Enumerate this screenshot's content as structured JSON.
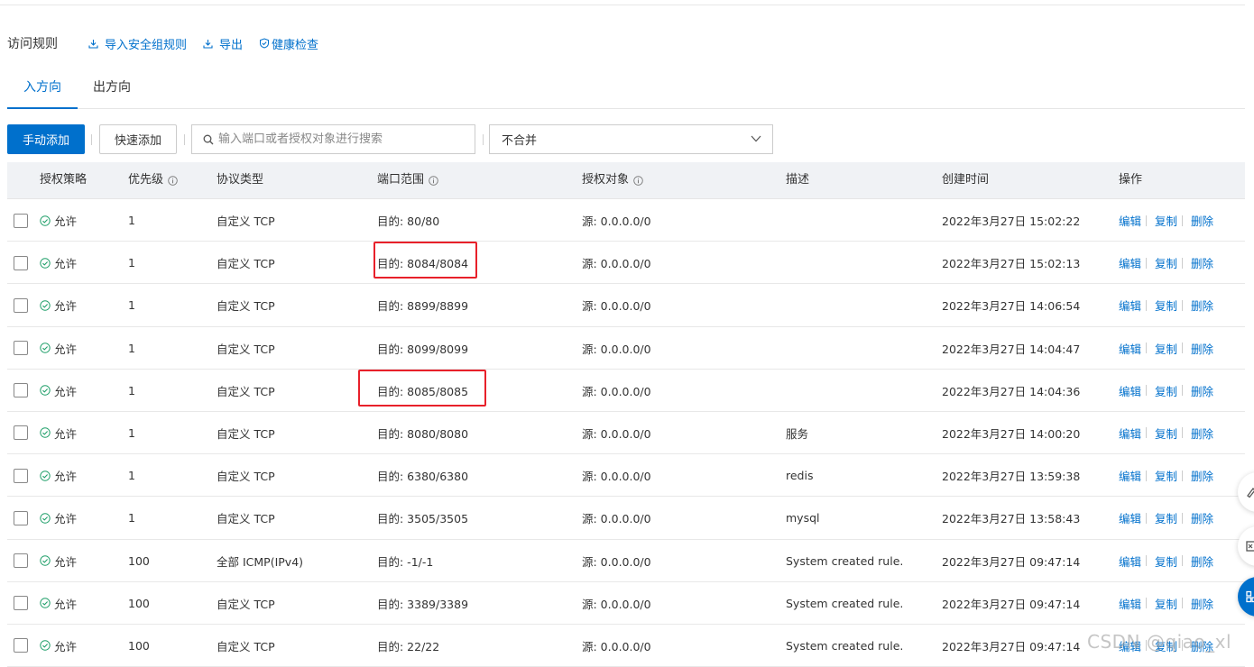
{
  "header": {
    "title": "访问规则",
    "links": [
      {
        "label": "导入安全组规则",
        "icon": "import-icon"
      },
      {
        "label": "导出",
        "icon": "export-icon"
      },
      {
        "label": "健康检查",
        "icon": "shield-check-icon"
      }
    ]
  },
  "tabs": [
    {
      "label": "入方向",
      "active": true
    },
    {
      "label": "出方向",
      "active": false
    }
  ],
  "toolbar": {
    "manual_add": "手动添加",
    "quick_add": "快速添加",
    "search_placeholder": "输入端口或者授权对象进行搜索",
    "merge_select": "不合并"
  },
  "table": {
    "columns": [
      "授权策略",
      "优先级",
      "协议类型",
      "端口范围",
      "授权对象",
      "描述",
      "创建时间",
      "操作"
    ],
    "actions": [
      "编辑",
      "复制",
      "删除"
    ],
    "rows": [
      {
        "policy": "允许",
        "priority": "1",
        "protocol": "自定义 TCP",
        "port": "目的: 80/80",
        "source": "源: 0.0.0.0/0",
        "desc": "",
        "created": "2022年3月27日 15:02:22",
        "highlight": false
      },
      {
        "policy": "允许",
        "priority": "1",
        "protocol": "自定义 TCP",
        "port": "目的: 8084/8084",
        "source": "源: 0.0.0.0/0",
        "desc": "",
        "created": "2022年3月27日 15:02:13",
        "highlight": true
      },
      {
        "policy": "允许",
        "priority": "1",
        "protocol": "自定义 TCP",
        "port": "目的: 8899/8899",
        "source": "源: 0.0.0.0/0",
        "desc": "",
        "created": "2022年3月27日 14:06:54",
        "highlight": false
      },
      {
        "policy": "允许",
        "priority": "1",
        "protocol": "自定义 TCP",
        "port": "目的: 8099/8099",
        "source": "源: 0.0.0.0/0",
        "desc": "",
        "created": "2022年3月27日 14:04:47",
        "highlight": false
      },
      {
        "policy": "允许",
        "priority": "1",
        "protocol": "自定义 TCP",
        "port": "目的: 8085/8085",
        "source": "源: 0.0.0.0/0",
        "desc": "",
        "created": "2022年3月27日 14:04:36",
        "highlight": true
      },
      {
        "policy": "允许",
        "priority": "1",
        "protocol": "自定义 TCP",
        "port": "目的: 8080/8080",
        "source": "源: 0.0.0.0/0",
        "desc": "服务",
        "created": "2022年3月27日 14:00:20",
        "highlight": false
      },
      {
        "policy": "允许",
        "priority": "1",
        "protocol": "自定义 TCP",
        "port": "目的: 6380/6380",
        "source": "源: 0.0.0.0/0",
        "desc": "redis",
        "created": "2022年3月27日 13:59:38",
        "highlight": false
      },
      {
        "policy": "允许",
        "priority": "1",
        "protocol": "自定义 TCP",
        "port": "目的: 3505/3505",
        "source": "源: 0.0.0.0/0",
        "desc": "mysql",
        "created": "2022年3月27日 13:58:43",
        "highlight": false
      },
      {
        "policy": "允许",
        "priority": "100",
        "protocol": "全部 ICMP(IPv4)",
        "port": "目的: -1/-1",
        "source": "源: 0.0.0.0/0",
        "desc": "System created rule.",
        "created": "2022年3月27日 09:47:14",
        "highlight": false
      },
      {
        "policy": "允许",
        "priority": "100",
        "protocol": "自定义 TCP",
        "port": "目的: 3389/3389",
        "source": "源: 0.0.0.0/0",
        "desc": "System created rule.",
        "created": "2022年3月27日 09:47:14",
        "highlight": false
      },
      {
        "policy": "允许",
        "priority": "100",
        "protocol": "自定义 TCP",
        "port": "目的: 22/22",
        "source": "源: 0.0.0.0/0",
        "desc": "System created rule.",
        "created": "2022年3月27日 09:47:14",
        "highlight": false
      }
    ]
  },
  "watermark": "CSDN @qiao_xl",
  "colors": {
    "accent": "#0070cc",
    "highlight_box": "#e8202a",
    "allow_green": "#22a06b"
  }
}
